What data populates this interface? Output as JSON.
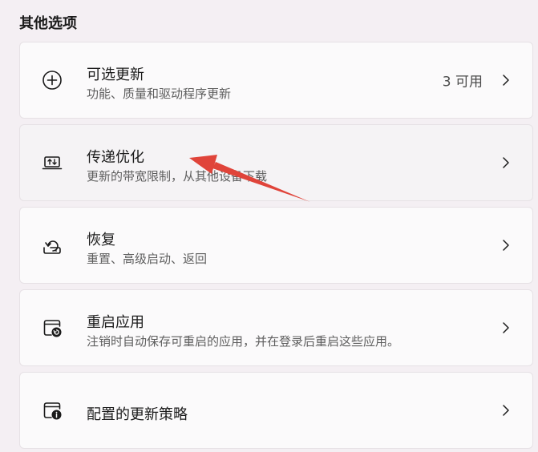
{
  "section": {
    "title": "其他选项"
  },
  "items": [
    {
      "title": "可选更新",
      "subtitle": "功能、质量和驱动程序更新",
      "status": "3 可用",
      "icon": "plus-circle-icon"
    },
    {
      "title": "传递优化",
      "subtitle": "更新的带宽限制，从其他设备下载",
      "icon": "laptop-transfer-icon"
    },
    {
      "title": "恢复",
      "subtitle": "重置、高级启动、返回",
      "icon": "recovery-icon"
    },
    {
      "title": "重启应用",
      "subtitle": "注销时自动保存可重启的应用，并在登录后重启这些应用。",
      "icon": "restart-apps-icon"
    },
    {
      "title": "配置的更新策略",
      "icon": "policy-info-icon"
    }
  ],
  "colors": {
    "annotation_arrow": "#e0443a",
    "background": "#f4eff3",
    "card": "#fbfafb"
  }
}
